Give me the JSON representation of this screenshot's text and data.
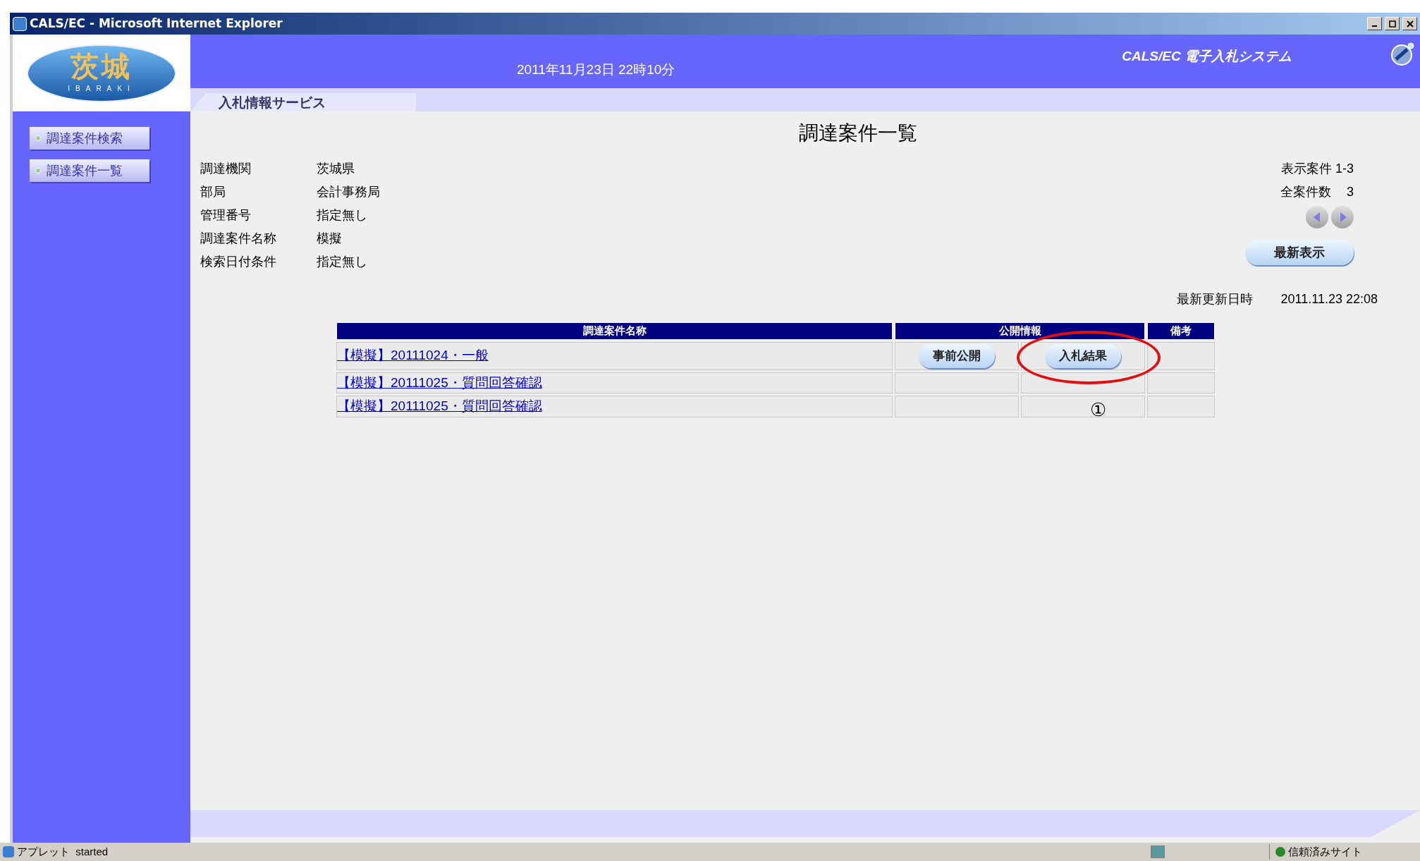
{
  "window": {
    "title": "CALS/EC - Microsoft Internet Explorer"
  },
  "header": {
    "logo_text": "茨城",
    "logo_subtext": "IBARAKI",
    "datetime": "2011年11月23日 22時10分",
    "system_name": "CALS/EC 電子入札システム",
    "service_name": "入札情報サービス"
  },
  "sidebar": {
    "items": [
      {
        "label": "調達案件検索"
      },
      {
        "label": "調達案件一覧"
      }
    ]
  },
  "page_title": "調達案件一覧",
  "conditions": [
    {
      "label": "調達機関",
      "value": "茨城県"
    },
    {
      "label": "部局",
      "value": "会計事務局"
    },
    {
      "label": "管理番号",
      "value": "指定無し"
    },
    {
      "label": "調達案件名称",
      "value": "模擬"
    },
    {
      "label": "検索日付条件",
      "value": "指定無し"
    }
  ],
  "paging": {
    "displayed": "表示案件 1-3",
    "total_label": "全案件数",
    "total": "3"
  },
  "refresh_button": "最新表示",
  "updated": {
    "label": "最新更新日時",
    "value": "2011.11.23 22:08"
  },
  "table": {
    "columns": [
      "調達案件名称",
      "公開情報",
      "備考"
    ],
    "rows": [
      {
        "name": "【模擬】20111024・一般",
        "actions": [
          {
            "label": "事前公開"
          },
          {
            "label": "入札結果"
          }
        ]
      },
      {
        "name": "【模擬】20111025・質問回答確認"
      },
      {
        "name": "【模擬】20111025・質問回答確認"
      }
    ]
  },
  "annotation": {
    "mark": "①"
  },
  "status_bar": {
    "text": "アプレット  started",
    "zone": "信頼済みサイト"
  }
}
